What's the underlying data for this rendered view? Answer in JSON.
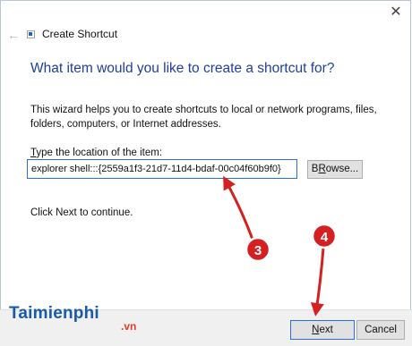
{
  "window": {
    "title": "Create Shortcut",
    "close_glyph": "✕",
    "back_glyph": "←"
  },
  "wizard": {
    "heading": "What item would you like to create a shortcut for?",
    "description": "This wizard helps you to create shortcuts to local or network programs, files, folders, computers, or Internet addresses.",
    "field_label_mnemonic": "T",
    "field_label_rest": "ype the location of the item:",
    "location_value": "explorer shell:::{2559a1f3-21d7-11d4-bdaf-00c04f60b9f0}",
    "browse_mnemonic": "R",
    "browse_prefix": "B",
    "browse_suffix": "owse...",
    "click_next": "Click Next to continue."
  },
  "footer": {
    "next_mnemonic": "N",
    "next_rest": "ext",
    "cancel_label": "Cancel"
  },
  "annotations": {
    "badge_3": "3",
    "badge_4": "4",
    "color": "#d42020"
  },
  "watermark": {
    "main": "Taimienphi",
    "suffix": ".vn"
  }
}
